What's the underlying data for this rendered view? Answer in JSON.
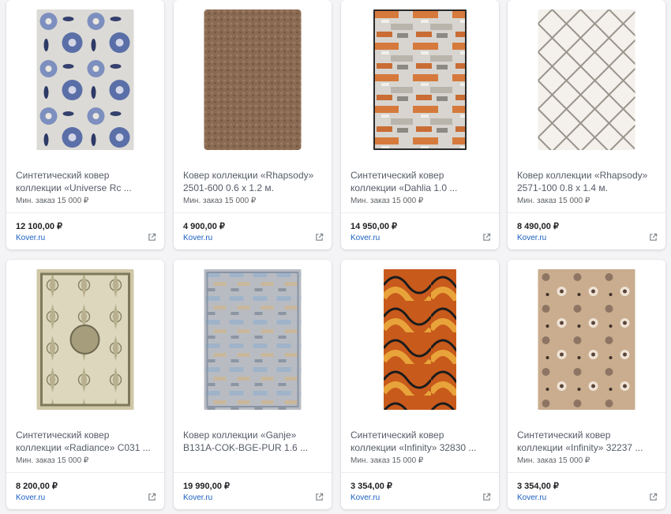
{
  "products": [
    {
      "title_line1": "Синтетический ковер",
      "title_line2": "коллекции «Universe Rc ...",
      "min_order": "Мин. заказ 15 000 ₽",
      "price": "12 100,00 ₽",
      "store": "Kover.ru",
      "icon": "external-link-icon"
    },
    {
      "title_line1": "Ковер коллекции «Rhapsody»",
      "title_line2": "2501-600 0.6 x 1.2 м.",
      "min_order": "Мин. заказ 15 000 ₽",
      "price": "4 900,00 ₽",
      "store": "Kover.ru",
      "icon": "external-link-icon"
    },
    {
      "title_line1": "Синтетический ковер",
      "title_line2": "коллекции «Dahlia 1.0 ...",
      "min_order": "Мин. заказ 15 000 ₽",
      "price": "14 950,00 ₽",
      "store": "Kover.ru",
      "icon": "external-link-icon"
    },
    {
      "title_line1": "Ковер коллекции «Rhapsody»",
      "title_line2": "2571-100 0.8 x 1.4 м.",
      "min_order": "Мин. заказ 15 000 ₽",
      "price": "8 490,00 ₽",
      "store": "Kover.ru",
      "icon": "external-link-icon"
    },
    {
      "title_line1": "Синтетический ковер",
      "title_line2": "коллекции «Radiance» C031 ...",
      "min_order": "Мин. заказ 15 000 ₽",
      "price": "8 200,00 ₽",
      "store": "Kover.ru",
      "icon": "external-link-icon"
    },
    {
      "title_line1": "Ковер коллекции «Ganje»",
      "title_line2": "B131A-COK-BGE-PUR 1.6 ...",
      "min_order": "",
      "price": "19 990,00 ₽",
      "store": "Kover.ru",
      "icon": "external-link-icon"
    },
    {
      "title_line1": "Синтетический ковер",
      "title_line2": "коллекции «Infinity» 32830 ...",
      "min_order": "Мин. заказ 15 000 ₽",
      "price": "3 354,00 ₽",
      "store": "Kover.ru",
      "icon": "external-link-icon"
    },
    {
      "title_line1": "Синтетический ковер",
      "title_line2": "коллекции «Infinity» 32237 ...",
      "min_order": "Мин. заказ 15 000 ₽",
      "price": "3 354,00 ₽",
      "store": "Kover.ru",
      "icon": "external-link-icon"
    }
  ],
  "colors": {
    "link": "#1a5fc1",
    "price": "#202124",
    "background": "#f4f4f6"
  }
}
